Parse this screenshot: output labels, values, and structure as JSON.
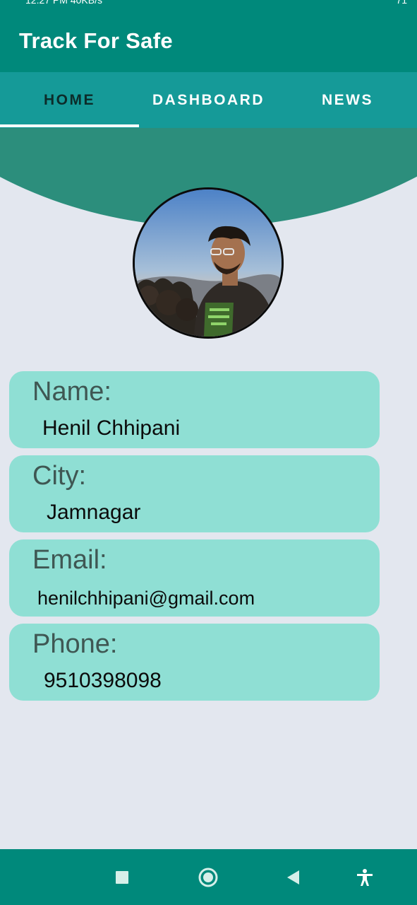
{
  "status_bar": {
    "time": "12:27 PM",
    "net_speed": "40KB/s",
    "battery": "71"
  },
  "app": {
    "title": "Track For Safe"
  },
  "tabs": [
    {
      "label": "HOME",
      "active": true
    },
    {
      "label": "DASHBOARD",
      "active": false
    },
    {
      "label": "NEWS",
      "active": false
    }
  ],
  "profile": {
    "avatar_icon": "profile-photo",
    "fields": [
      {
        "label": "Name:",
        "value": "Henil Chhipani"
      },
      {
        "label": "City:",
        "value": "Jamnagar"
      },
      {
        "label": "Email:",
        "value": "henilchhipani@gmail.com"
      },
      {
        "label": "Phone:",
        "value": "9510398098"
      }
    ]
  },
  "nav": {
    "items": [
      "recents-square-icon",
      "home-circle-icon",
      "back-triangle-icon",
      "accessibility-icon"
    ]
  },
  "colors": {
    "primary": "#00897b",
    "tab_bar": "#159a98",
    "arc": "#2c8e7c",
    "card": "#8fdfd4",
    "background": "#e3e7ef"
  }
}
